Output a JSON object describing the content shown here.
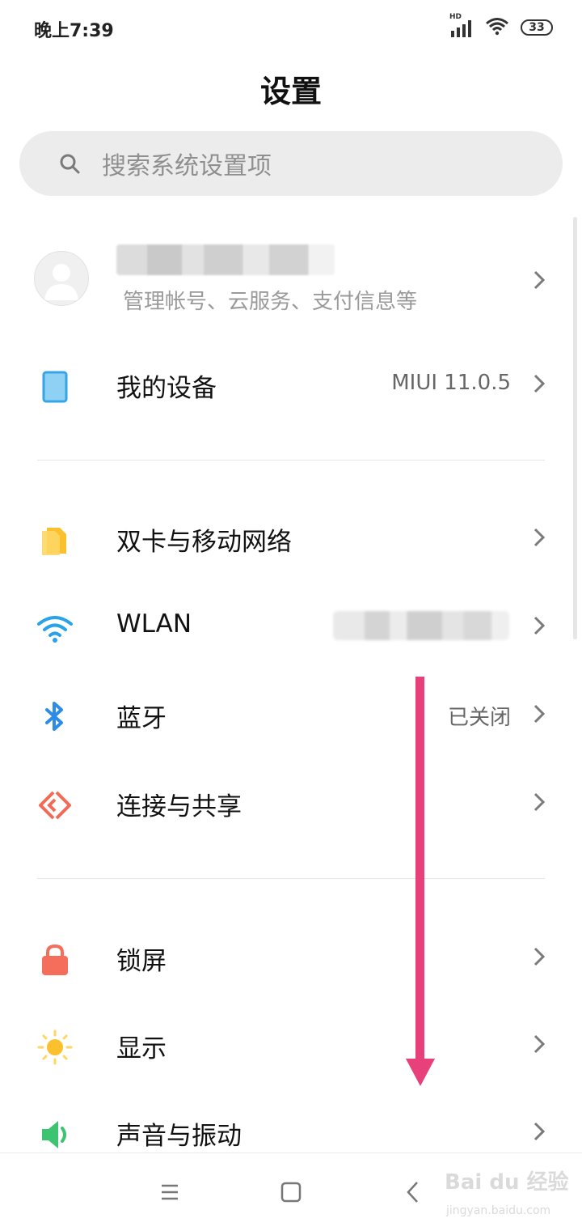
{
  "status_bar": {
    "time": "晚上7:39",
    "network_badge": "HD",
    "battery_level": "33",
    "icons": [
      "signal-icon",
      "wifi-icon",
      "battery-icon"
    ]
  },
  "page_title": "设置",
  "search": {
    "placeholder": "搜索系统设置项"
  },
  "account": {
    "subtitle": "管理帐号、云服务、支付信息等"
  },
  "my_device": {
    "label": "我的设备",
    "value": "MIUI 11.0.5"
  },
  "network_section": [
    {
      "label": "双卡与移动网络",
      "value": "",
      "icon": "sim-card-icon",
      "color": "#FBC02D"
    },
    {
      "label": "WLAN",
      "value": "",
      "icon": "wifi-icon",
      "color": "#29A3E8"
    },
    {
      "label": "蓝牙",
      "value": "已关闭",
      "icon": "bluetooth-icon",
      "color": "#2D8DE6"
    },
    {
      "label": "连接与共享",
      "value": "",
      "icon": "connection-share-icon",
      "color": "#F26A55"
    }
  ],
  "personal_section": [
    {
      "label": "锁屏",
      "icon": "lock-icon",
      "color": "#F46E5B"
    },
    {
      "label": "显示",
      "icon": "sun-icon",
      "color": "#FBC02D"
    },
    {
      "label": "声音与振动",
      "icon": "speaker-icon",
      "color": "#3CC471"
    }
  ],
  "annotation_color": "#E8407A",
  "watermark": {
    "brand": "Bai du 经验",
    "url": "jingyan.baidu.com"
  }
}
